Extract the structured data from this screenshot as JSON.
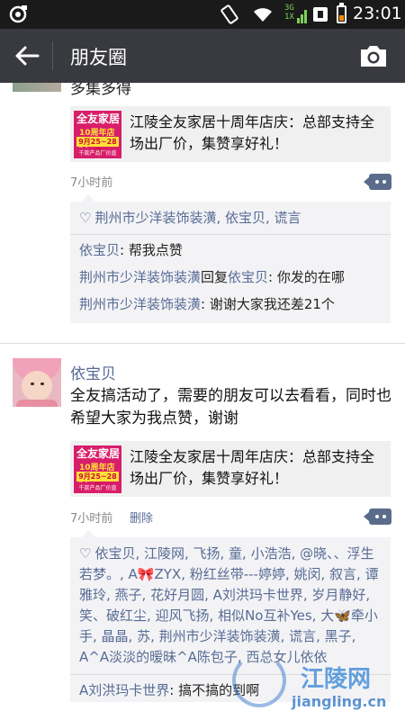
{
  "status_bar": {
    "network_label": "3G",
    "sim_label": "1X",
    "time": "23:01",
    "battery_color": "#ff8a00"
  },
  "app_bar": {
    "back_icon": "arrow-left-icon",
    "title": "朋友圈",
    "camera_icon": "camera-icon"
  },
  "feed": {
    "top_post": {
      "cut_text": "多集多得",
      "share": {
        "thumb_brand": "全友家居",
        "thumb_line2": "10周年店庆",
        "thumb_date": "9月25~28日",
        "thumb_footer": "千款产品厂价直销",
        "text": "江陵全友家居十周年店庆：总部支持全场出厂价，集赞享好礼！"
      },
      "time": "7小时前",
      "likes": "荆州市少洋装饰装潢, 依宝贝, 谎言",
      "comments": [
        {
          "user": "依宝贝",
          "reply_label": "",
          "reply_to": "",
          "text": ": 帮我点赞"
        },
        {
          "user": "荆州市少洋装饰装潢",
          "reply_label": "回复",
          "reply_to": "依宝贝",
          "text": ": 你发的在哪"
        },
        {
          "user": "荆州市少洋装饰装潢",
          "reply_label": "",
          "reply_to": "",
          "text": ": 谢谢大家我还差21个"
        }
      ]
    },
    "post2": {
      "username": "依宝贝",
      "text": "全友搞活动了，需要的朋友可以去看看，同时也希望大家为我点赞，谢谢",
      "share": {
        "thumb_brand": "全友家居",
        "thumb_line2": "10周年店庆",
        "thumb_date": "9月25~28日",
        "thumb_footer": "千款产品厂价直销",
        "text": "江陵全友家居十周年店庆：总部支持全场出厂价，集赞享好礼！"
      },
      "time": "7小时前",
      "delete_label": "删除",
      "likes": "依宝贝, 江陵网, 飞扬, 童, 小浩浩, @晓、、浮生若梦。, A🎀ZYX, 粉红丝带---婷婷, 姚闵, 叙言, 谭雅玲, 燕子, 花好月圆, A刘洪玛卡世界, 岁月静好, 笑、破红尘, 迎风飞扬, 相似No互补Yes, 大🦋牵小手, 晶晶, 苏, 荆州市少洋装饰装潢, 谎言, 黑子, A^A淡淡的暧昧^A陈包子, 西总女儿依依",
      "comments": [
        {
          "user": "A刘洪玛卡世界",
          "text": ": 搞不搞的到啊"
        }
      ]
    }
  },
  "watermark": {
    "name": "江陵网",
    "url": "jiangling.cn"
  }
}
